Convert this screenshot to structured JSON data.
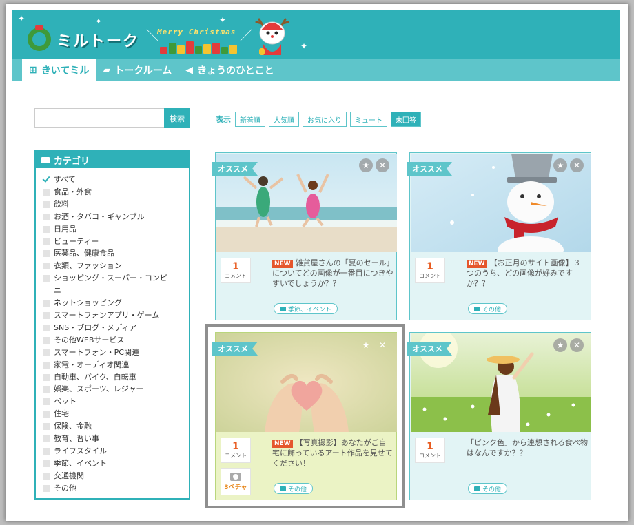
{
  "header": {
    "logo_text": "ミルトーク",
    "campaign_text": "Merry Christmas"
  },
  "nav": [
    {
      "label": "きいてミル",
      "icon": "question-board-icon",
      "active": true
    },
    {
      "label": "トークルーム",
      "icon": "chat-bubbles-icon",
      "active": false
    },
    {
      "label": "きょうのひとこと",
      "icon": "megaphone-icon",
      "active": false
    }
  ],
  "search": {
    "placeholder": "",
    "button_label": "検索"
  },
  "filter": {
    "label": "表示",
    "options": [
      "新着順",
      "人気順",
      "お気に入り",
      "ミュート",
      "未回答"
    ],
    "active": "未回答"
  },
  "category": {
    "title": "カテゴリ",
    "items": [
      {
        "label": "すべて",
        "checked": true
      },
      {
        "label": "食品・外食",
        "checked": false
      },
      {
        "label": "飲料",
        "checked": false
      },
      {
        "label": "お酒・タバコ・ギャンブル",
        "checked": false
      },
      {
        "label": "日用品",
        "checked": false
      },
      {
        "label": "ビューティー",
        "checked": false
      },
      {
        "label": "医薬品、健康食品",
        "checked": false
      },
      {
        "label": "衣類、ファッション",
        "checked": false
      },
      {
        "label": "ショッピング・スーパー・コンビニ",
        "checked": false
      },
      {
        "label": "ネットショッピング",
        "checked": false
      },
      {
        "label": "スマートフォンアプリ・ゲーム",
        "checked": false
      },
      {
        "label": "SNS・ブログ・メディア",
        "checked": false
      },
      {
        "label": "その他WEBサービス",
        "checked": false
      },
      {
        "label": "スマートフォン・PC関連",
        "checked": false
      },
      {
        "label": "家電・オーディオ関連",
        "checked": false
      },
      {
        "label": "自動車、バイク、自転車",
        "checked": false
      },
      {
        "label": "娯楽、スポーツ、レジャー",
        "checked": false
      },
      {
        "label": "ペット",
        "checked": false
      },
      {
        "label": "住宅",
        "checked": false
      },
      {
        "label": "保険、金融",
        "checked": false
      },
      {
        "label": "教育、習い事",
        "checked": false
      },
      {
        "label": "ライフスタイル",
        "checked": false
      },
      {
        "label": "季節、イベント",
        "checked": false
      },
      {
        "label": "交通機関",
        "checked": false
      },
      {
        "label": "その他",
        "checked": false
      }
    ]
  },
  "cards": [
    {
      "badge": "オススメ",
      "comment_count": "1",
      "comment_unit": "コメント",
      "new_label": "NEW",
      "text": "雑貨屋さんの「夏のセール」についてどの画像が一番目につきやすいでしょうか？？",
      "tag": "季節、イベント",
      "photo": "beach-jump-photo"
    },
    {
      "badge": "オススメ",
      "comment_count": "1",
      "comment_unit": "コメント",
      "new_label": "NEW",
      "text": "【お正月のサイト画像】３つのうち、どの画像が好みですか？？",
      "tag": "その他",
      "photo": "snowman-photo"
    },
    {
      "badge": "オススメ",
      "comment_count": "1",
      "comment_unit": "コメント",
      "new_label": "NEW",
      "text": "【写真撮影】あなたがご自宅に飾っているアート作品を見せてください！",
      "tag": "その他",
      "photo": "heart-hands-photo",
      "photo_count": "3ペチャ"
    },
    {
      "badge": "オススメ",
      "comment_count": "1",
      "comment_unit": "コメント",
      "new_label": "",
      "text": "「ピンク色」から連想される食べ物はなんですか？？",
      "tag": "その他",
      "photo": "flower-field-photo"
    }
  ],
  "colors": {
    "accent": "#2fb1b8",
    "nav": "#5ec5ca",
    "new": "#e5562c",
    "highlight_card": "#ebf3c5"
  }
}
